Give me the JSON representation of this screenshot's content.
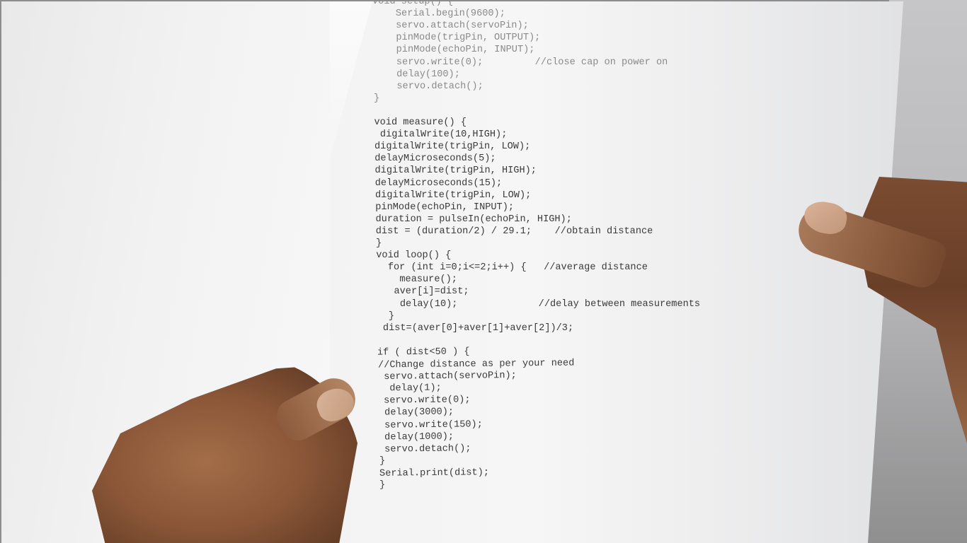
{
  "document": {
    "type": "printed Arduino sketch held in hands",
    "code_lines": [
      {
        "text": "void setup() {",
        "faint": true
      },
      {
        "text": "    Serial.begin(9600);",
        "faint": true
      },
      {
        "text": "    servo.attach(servoPin);",
        "faint": true
      },
      {
        "text": "    pinMode(trigPin, OUTPUT);",
        "faint": true
      },
      {
        "text": "    pinMode(echoPin, INPUT);",
        "faint": true
      },
      {
        "text": "    servo.write(0);         //close cap on power on",
        "faint": true
      },
      {
        "text": "    delay(100);",
        "faint": true
      },
      {
        "text": "    servo.detach();",
        "faint": true
      },
      {
        "text": "}",
        "faint": true
      },
      {
        "text": "",
        "faint": false
      },
      {
        "text": "void measure() {",
        "faint": false
      },
      {
        "text": " digitalWrite(10,HIGH);",
        "faint": false
      },
      {
        "text": "digitalWrite(trigPin, LOW);",
        "faint": false
      },
      {
        "text": "delayMicroseconds(5);",
        "faint": false
      },
      {
        "text": "digitalWrite(trigPin, HIGH);",
        "faint": false
      },
      {
        "text": "delayMicroseconds(15);",
        "faint": false
      },
      {
        "text": "digitalWrite(trigPin, LOW);",
        "faint": false
      },
      {
        "text": "pinMode(echoPin, INPUT);",
        "faint": false
      },
      {
        "text": "duration = pulseIn(echoPin, HIGH);",
        "faint": false
      },
      {
        "text": "dist = (duration/2) / 29.1;    //obtain distance",
        "faint": false
      },
      {
        "text": "}",
        "faint": false
      },
      {
        "text": "void loop() {",
        "faint": false
      },
      {
        "text": "  for (int i=0;i<=2;i++) {   //average distance",
        "faint": false
      },
      {
        "text": "    measure();",
        "faint": false
      },
      {
        "text": "   aver[i]=dist;",
        "faint": false
      },
      {
        "text": "    delay(10);              //delay between measurements",
        "faint": false
      },
      {
        "text": "  }",
        "faint": false
      },
      {
        "text": " dist=(aver[0]+aver[1]+aver[2])/3;",
        "faint": false
      },
      {
        "text": "",
        "faint": false
      },
      {
        "text": "if ( dist<50 ) {",
        "faint": false
      },
      {
        "text": "//Change distance as per your need",
        "faint": false
      },
      {
        "text": " servo.attach(servoPin);",
        "faint": false
      },
      {
        "text": "  delay(1);",
        "faint": false
      },
      {
        "text": " servo.write(0);",
        "faint": false
      },
      {
        "text": " delay(3000);",
        "faint": false
      },
      {
        "text": " servo.write(150);",
        "faint": false
      },
      {
        "text": " delay(1000);",
        "faint": false
      },
      {
        "text": " servo.detach();",
        "faint": false
      },
      {
        "text": "}",
        "faint": false
      },
      {
        "text": "Serial.print(dist);",
        "faint": false
      },
      {
        "text": "}",
        "faint": false
      }
    ]
  }
}
